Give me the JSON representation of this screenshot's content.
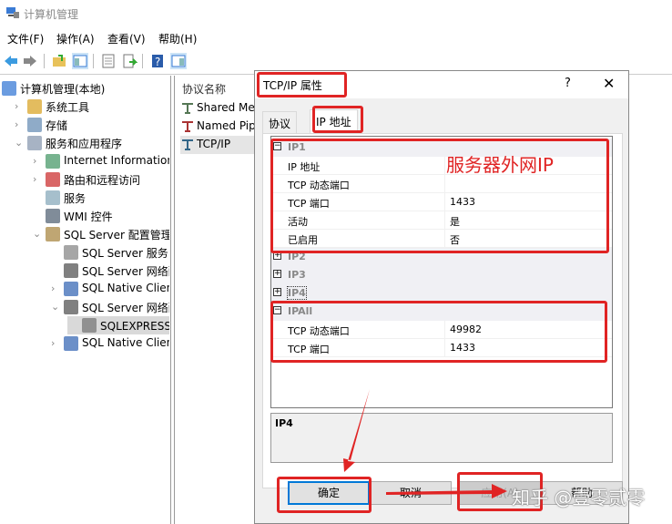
{
  "window": {
    "title": "计算机管理"
  },
  "menu": [
    "文件(F)",
    "操作(A)",
    "查看(V)",
    "帮助(H)"
  ],
  "toolbar": {
    "icons": [
      "back-icon",
      "forward-icon",
      "up-folder-icon",
      "show-hide-tree-icon",
      "properties-icon",
      "export-list-icon",
      "help-icon",
      "show-hide-action-pane-icon"
    ]
  },
  "tree": {
    "items": [
      {
        "label": "计算机管理(本地)",
        "icon": "computer-management-icon",
        "chev": ""
      },
      {
        "label": "系统工具",
        "icon": "tools-icon",
        "chev": ">"
      },
      {
        "label": "存储",
        "icon": "storage-icon",
        "chev": ">"
      },
      {
        "label": "服务和应用程序",
        "icon": "services-apps-icon",
        "chev": "v"
      },
      {
        "label": "Internet Information Se",
        "icon": "iis-icon",
        "chev": ">"
      },
      {
        "label": "路由和远程访问",
        "icon": "routing-icon",
        "chev": ">"
      },
      {
        "label": "服务",
        "icon": "services-gear-icon",
        "chev": ""
      },
      {
        "label": "WMI 控件",
        "icon": "wmi-icon",
        "chev": ""
      },
      {
        "label": "SQL Server 配置管理器",
        "icon": "sql-config-icon",
        "chev": "v"
      },
      {
        "label": "SQL Server 服务",
        "icon": "sql-service-icon",
        "chev": ""
      },
      {
        "label": "SQL Server 网络配置",
        "icon": "sql-network-icon",
        "chev": ""
      },
      {
        "label": "SQL Native Client",
        "icon": "native-client-icon",
        "chev": ">"
      },
      {
        "label": "SQL Server 网络配置",
        "icon": "sql-network-icon",
        "chev": "v"
      },
      {
        "label": "SQLEXPRESS 的协议",
        "icon": "protocol-icon",
        "chev": ""
      },
      {
        "label": "SQL Native Client",
        "icon": "native-client-icon",
        "chev": ">"
      }
    ]
  },
  "list": {
    "header": "协议名称",
    "rows": [
      "Shared Memory",
      "Named Pipes",
      "TCP/IP"
    ]
  },
  "dialog": {
    "title": "TCP/IP 属性",
    "help": "?",
    "close": "✕",
    "tabs": [
      "协议",
      "IP 地址"
    ],
    "groups": [
      {
        "name": "IP1",
        "expanded": true,
        "props": [
          {
            "k": "IP 地址",
            "v": ""
          },
          {
            "k": "TCP 动态端口",
            "v": ""
          },
          {
            "k": "TCP 端口",
            "v": "1433"
          },
          {
            "k": "活动",
            "v": "是"
          },
          {
            "k": "已启用",
            "v": "否"
          }
        ]
      },
      {
        "name": "IP2",
        "expanded": false,
        "props": []
      },
      {
        "name": "IP3",
        "expanded": false,
        "props": []
      },
      {
        "name": "IP4",
        "expanded": false,
        "props": []
      },
      {
        "name": "IPAll",
        "expanded": true,
        "props": [
          {
            "k": "TCP 动态端口",
            "v": "49982"
          },
          {
            "k": "TCP 端口",
            "v": "1433"
          }
        ]
      }
    ],
    "description": "IP4",
    "buttons": {
      "ok": "确定",
      "cancel": "取消",
      "apply": "应用(A)",
      "help": "帮助"
    }
  },
  "annotations": {
    "note": "服务器外网IP",
    "color": "#e02424"
  },
  "watermark": "知乎 @壹零贰零"
}
